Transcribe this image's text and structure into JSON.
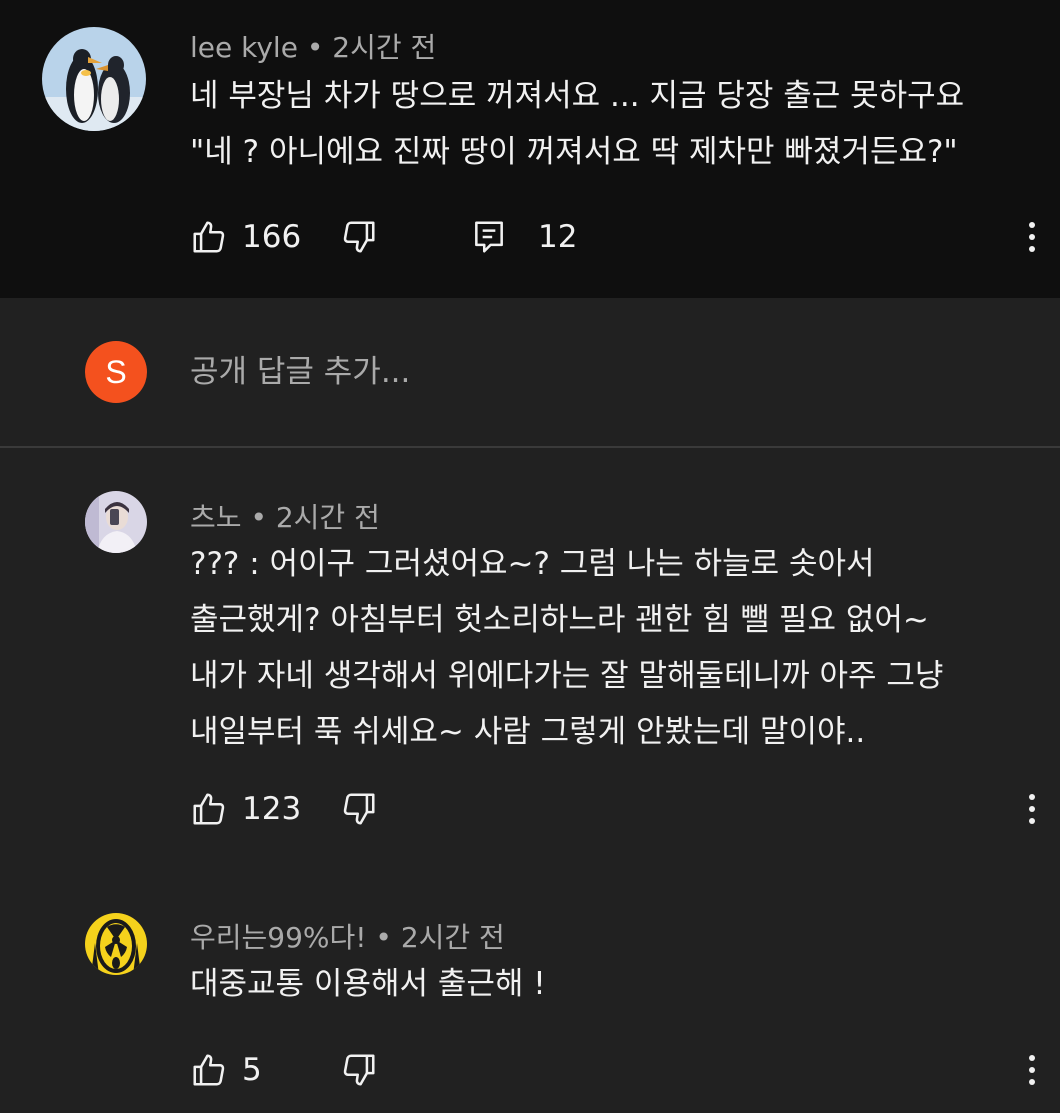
{
  "comments": [
    {
      "author": "lee kyle",
      "time": "• 2시간 전",
      "text": "네 부장님 차가 땅으로 꺼져서요 ... 지금 당장 출근 못하구요\n\"네 ? 아니에요 진짜 땅이 꺼져서요 딱 제차만 빠졌거든요?\"",
      "likes": "166",
      "replies": "12",
      "avatar_icon": "penguin-avatar"
    },
    {
      "author": "츠노",
      "time": "• 2시간 전",
      "text": "??? : 어이구 그러셨어요~? 그럼 나는 하늘로 솟아서\n출근했게? 아침부터 헛소리하느라 괜한 힘 뺄 필요 없어~\n내가 자네 생각해서 위에다가는 잘 말해둘테니까 아주 그냥\n내일부터 푹 쉬세요~ 사람 그렇게 안봤는데 말이야..",
      "likes": "123",
      "avatar_icon": "person-selfie-avatar"
    },
    {
      "author": "우리는99%다!",
      "time": "• 2시간 전",
      "text": "대중교통 이용해서 출근해 !",
      "likes": "5",
      "avatar_icon": "radiation-scream-avatar"
    }
  ],
  "reply": {
    "avatar_letter": "S",
    "placeholder": "공개 답글 추가..."
  },
  "colors": {
    "top_bg": "#0f0f0f",
    "page_bg": "#212121",
    "meta_text": "#aaaaaa",
    "main_text": "#f1f1f1",
    "reply_avatar": "#f4511e"
  }
}
